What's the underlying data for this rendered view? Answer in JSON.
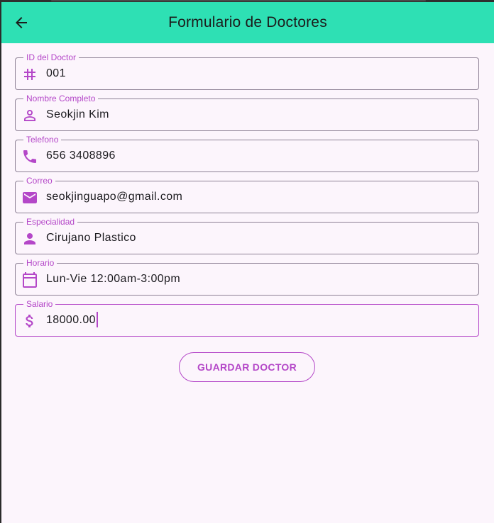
{
  "appbar": {
    "title": "Formulario de Doctores",
    "back_icon": "arrow-back-icon"
  },
  "form": {
    "fields": [
      {
        "label": "ID del Doctor",
        "value": "001",
        "icon": "hash-icon"
      },
      {
        "label": "Nombre Completo",
        "value": "Seokjin Kim",
        "icon": "person-outline-icon"
      },
      {
        "label": "Telefono",
        "value": "656 3408896",
        "icon": "phone-icon"
      },
      {
        "label": "Correo",
        "value": "seokjinguapo@gmail.com",
        "icon": "email-icon"
      },
      {
        "label": "Especialidad",
        "value": "Cirujano Plastico",
        "icon": "person-icon"
      },
      {
        "label": "Horario",
        "value": "Lun-Vie 12:00am-3:00pm",
        "icon": "calendar-icon"
      },
      {
        "label": "Salario",
        "value": "18000.00",
        "icon": "dollar-icon"
      }
    ],
    "save_label": "GUARDAR DOCTOR"
  },
  "colors": {
    "appbar": "#2ee0b4",
    "accent": "#b447c8",
    "background": "#fcf5fc",
    "outline": "#8d8195"
  }
}
